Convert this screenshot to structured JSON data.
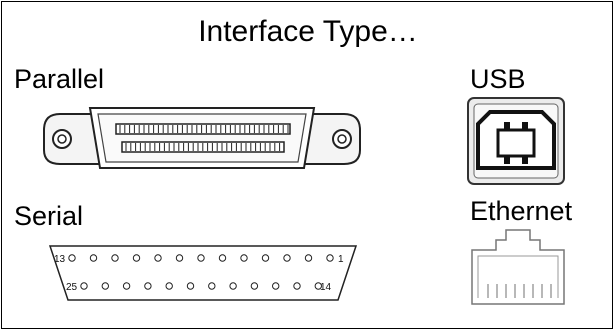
{
  "title": "Interface Type…",
  "connectors": {
    "parallel": {
      "label": "Parallel",
      "icon": "parallel-port-icon"
    },
    "usb": {
      "label": "USB",
      "icon": "usb-b-port-icon"
    },
    "serial": {
      "label": "Serial",
      "icon": "db25-serial-port-icon",
      "top_row_start": "13",
      "top_row_end": "1",
      "bottom_row_start": "25",
      "bottom_row_end": "14"
    },
    "ethernet": {
      "label": "Ethernet",
      "icon": "rj45-ethernet-port-icon"
    }
  }
}
